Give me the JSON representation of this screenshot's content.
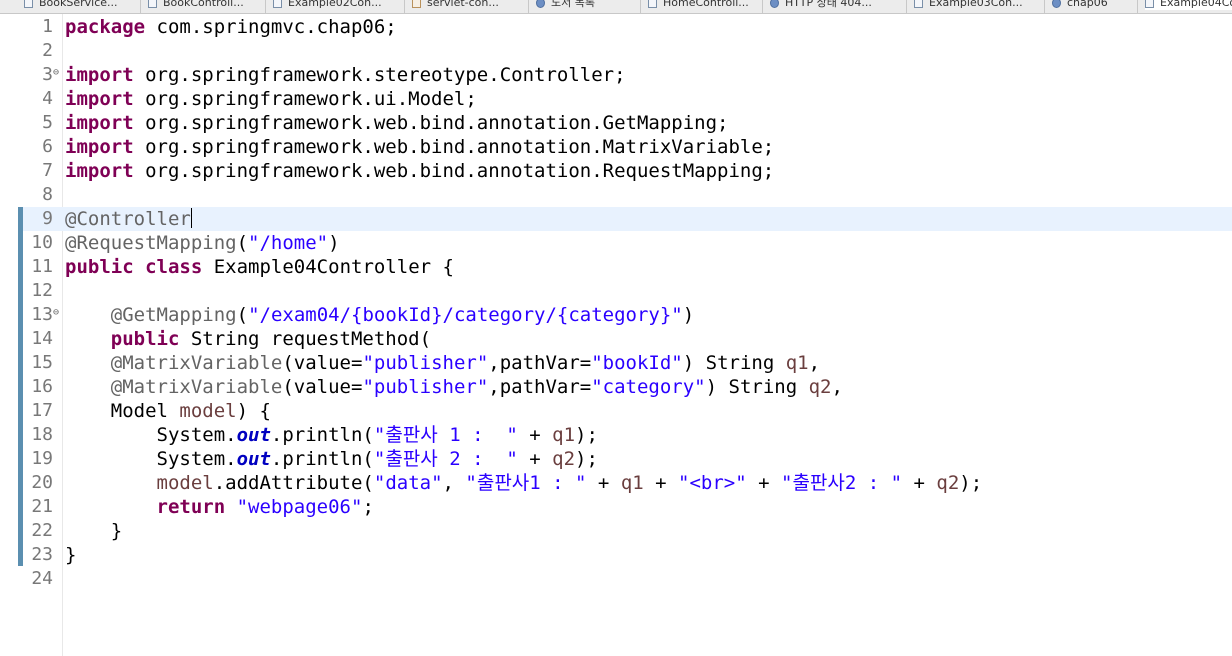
{
  "tabs": [
    {
      "label": "BookService...",
      "icon": "java-file-icon"
    },
    {
      "label": "BookControll...",
      "icon": "java-file-icon"
    },
    {
      "label": "Example02Con...",
      "icon": "java-file-icon"
    },
    {
      "label": "servlet-con...",
      "icon": "xml-file-icon"
    },
    {
      "label": "도서 목록",
      "icon": "globe-icon"
    },
    {
      "label": "HomeControll...",
      "icon": "java-file-icon"
    },
    {
      "label": "HTTP 상태 404...",
      "icon": "globe-icon"
    },
    {
      "label": "Example03Con...",
      "icon": "java-file-icon"
    },
    {
      "label": "chap06",
      "icon": "globe-icon"
    },
    {
      "label": "Example04Co",
      "icon": "java-file-icon"
    }
  ],
  "editor": {
    "current_line": 9,
    "lines": [
      {
        "n": "1",
        "t": [
          {
            "c": "kw",
            "v": "package"
          },
          {
            "v": " com.springmvc.chap06;"
          }
        ]
      },
      {
        "n": "2",
        "t": []
      },
      {
        "n": "3",
        "fold": true,
        "t": [
          {
            "c": "kw",
            "v": "import"
          },
          {
            "v": " org.springframework.stereotype.Controller;"
          }
        ]
      },
      {
        "n": "4",
        "t": [
          {
            "c": "kw",
            "v": "import"
          },
          {
            "v": " org.springframework.ui.Model;"
          }
        ]
      },
      {
        "n": "5",
        "t": [
          {
            "c": "kw",
            "v": "import"
          },
          {
            "v": " org.springframework.web.bind.annotation.GetMapping;"
          }
        ]
      },
      {
        "n": "6",
        "t": [
          {
            "c": "kw",
            "v": "import"
          },
          {
            "v": " org.springframework.web.bind.annotation.MatrixVariable;"
          }
        ]
      },
      {
        "n": "7",
        "t": [
          {
            "c": "kw",
            "v": "import"
          },
          {
            "v": " org.springframework.web.bind.annotation.RequestMapping;"
          }
        ]
      },
      {
        "n": "8",
        "t": []
      },
      {
        "n": "9",
        "caret": true,
        "t": [
          {
            "c": "ann",
            "v": "@Controller"
          }
        ]
      },
      {
        "n": "10",
        "t": [
          {
            "c": "ann",
            "v": "@RequestMapping"
          },
          {
            "v": "("
          },
          {
            "c": "str",
            "v": "\"/home\""
          },
          {
            "v": ")"
          }
        ]
      },
      {
        "n": "11",
        "t": [
          {
            "c": "kw",
            "v": "public"
          },
          {
            "v": " "
          },
          {
            "c": "kw",
            "v": "class"
          },
          {
            "v": " Example04Controller {"
          }
        ]
      },
      {
        "n": "12",
        "t": []
      },
      {
        "n": "13",
        "fold": true,
        "t": [
          {
            "v": "    "
          },
          {
            "c": "ann",
            "v": "@GetMapping"
          },
          {
            "v": "("
          },
          {
            "c": "str",
            "v": "\"/exam04/{bookId}/category/{category}\""
          },
          {
            "v": ")"
          }
        ]
      },
      {
        "n": "14",
        "t": [
          {
            "v": "    "
          },
          {
            "c": "kw",
            "v": "public"
          },
          {
            "v": " String requestMethod("
          }
        ]
      },
      {
        "n": "15",
        "t": [
          {
            "v": "    "
          },
          {
            "c": "ann",
            "v": "@MatrixVariable"
          },
          {
            "v": "(value="
          },
          {
            "c": "str",
            "v": "\"publisher\""
          },
          {
            "v": ",pathVar="
          },
          {
            "c": "str",
            "v": "\"bookId\""
          },
          {
            "v": ") String "
          },
          {
            "c": "var",
            "v": "q1"
          },
          {
            "v": ","
          }
        ]
      },
      {
        "n": "16",
        "t": [
          {
            "v": "    "
          },
          {
            "c": "ann",
            "v": "@MatrixVariable"
          },
          {
            "v": "(value="
          },
          {
            "c": "str",
            "v": "\"publisher\""
          },
          {
            "v": ",pathVar="
          },
          {
            "c": "str",
            "v": "\"category\""
          },
          {
            "v": ") String "
          },
          {
            "c": "var",
            "v": "q2"
          },
          {
            "v": ","
          }
        ]
      },
      {
        "n": "17",
        "t": [
          {
            "v": "    Model "
          },
          {
            "c": "var",
            "v": "model"
          },
          {
            "v": ") {"
          }
        ]
      },
      {
        "n": "18",
        "t": [
          {
            "v": "        System."
          },
          {
            "c": "fld",
            "v": "out"
          },
          {
            "v": ".println("
          },
          {
            "c": "str",
            "v": "\"출판사 1 :  \""
          },
          {
            "v": " + "
          },
          {
            "c": "var",
            "v": "q1"
          },
          {
            "v": ");"
          }
        ]
      },
      {
        "n": "19",
        "t": [
          {
            "v": "        System."
          },
          {
            "c": "fld",
            "v": "out"
          },
          {
            "v": ".println("
          },
          {
            "c": "str",
            "v": "\"출판사 2 :  \""
          },
          {
            "v": " + "
          },
          {
            "c": "var",
            "v": "q2"
          },
          {
            "v": ");"
          }
        ]
      },
      {
        "n": "20",
        "t": [
          {
            "v": "        "
          },
          {
            "c": "var",
            "v": "model"
          },
          {
            "v": ".addAttribute("
          },
          {
            "c": "str",
            "v": "\"data\""
          },
          {
            "v": ", "
          },
          {
            "c": "str",
            "v": "\"출판사1 : \""
          },
          {
            "v": " + "
          },
          {
            "c": "var",
            "v": "q1"
          },
          {
            "v": " + "
          },
          {
            "c": "str",
            "v": "\"<br>\""
          },
          {
            "v": " + "
          },
          {
            "c": "str",
            "v": "\"출판사2 : \""
          },
          {
            "v": " + "
          },
          {
            "c": "var",
            "v": "q2"
          },
          {
            "v": ");"
          }
        ]
      },
      {
        "n": "21",
        "t": [
          {
            "v": "        "
          },
          {
            "c": "kw",
            "v": "return"
          },
          {
            "v": " "
          },
          {
            "c": "str",
            "v": "\"webpage06\""
          },
          {
            "v": ";"
          }
        ]
      },
      {
        "n": "22",
        "t": [
          {
            "v": "    }"
          }
        ]
      },
      {
        "n": "23",
        "t": [
          {
            "v": "}"
          }
        ]
      },
      {
        "n": "24",
        "t": []
      }
    ]
  }
}
